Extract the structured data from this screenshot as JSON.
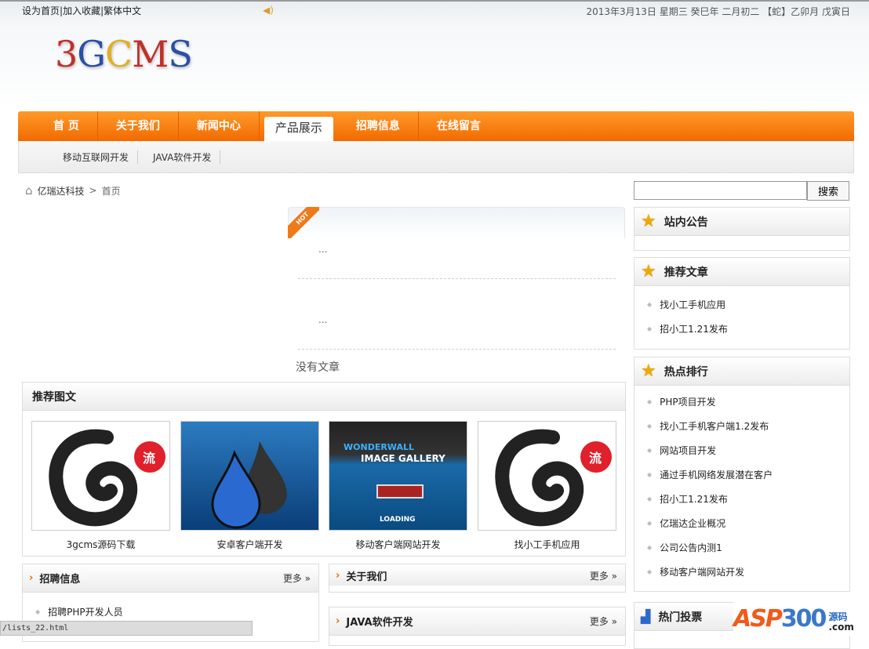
{
  "topbar": {
    "links": [
      "设为首页",
      "加入收藏",
      "繁体中文"
    ],
    "separator": "|",
    "date": "2013年3月13日 星期三  癸巳年 二月初二 【蛇】乙卯月 戊寅日"
  },
  "logo": {
    "text": "3GCMS",
    "letters": [
      "3",
      "G",
      "C",
      "M",
      "S"
    ],
    "colors": [
      "#c0302a",
      "#2a4fa8",
      "#e0b020",
      "#c0302a",
      "#2a4fa8"
    ]
  },
  "nav": {
    "items": [
      "首 页",
      "关于我们",
      "新闻中心",
      "产品展示",
      "招聘信息",
      "在线留言"
    ],
    "active": 3,
    "accent": "#f57a0a"
  },
  "subnav": {
    "items": [
      "移动互联网开发",
      "JAVA软件开发"
    ]
  },
  "breadcrumb": {
    "items": [
      "亿瑞达科技",
      "首页"
    ],
    "separator": ">"
  },
  "hot": {
    "badge": "HOT",
    "rows": [
      "...",
      "..."
    ],
    "empty": "没有文章"
  },
  "pictures": {
    "title": "推荐图文",
    "items": [
      {
        "caption": "3gcms源码下载",
        "badge": "流"
      },
      {
        "caption": "安卓客户端开发"
      },
      {
        "caption": "移动客户端网站开发",
        "line1": "WONDERWALL",
        "line2": "IMAGE GALLERY",
        "line3": "LOADING"
      },
      {
        "caption": "找小工手机应用",
        "badge": "流"
      }
    ]
  },
  "boxes": {
    "jobs": {
      "title": "招聘信息",
      "more": "更多 »",
      "items": [
        "招聘PHP开发人员"
      ]
    },
    "about": {
      "title": "关于我们",
      "more": "更多 »"
    },
    "java": {
      "title": "JAVA软件开发",
      "more": "更多 »"
    }
  },
  "search": {
    "value": "",
    "button": "搜索"
  },
  "sidebar": {
    "notice": {
      "title": "站内公告"
    },
    "recommend": {
      "title": "推荐文章",
      "items": [
        "找小工手机应用",
        "招小工1.21发布"
      ]
    },
    "hot": {
      "title": "热点排行",
      "items": [
        "PHP项目开发",
        "找小工手机客户端1.2发布",
        "网站项目开发",
        "通过手机网络发展潜在客户",
        "招小工1.21发布",
        "亿瑞达企业概况",
        "公司公告内测1",
        "移动客户端网站开发"
      ]
    },
    "vote": {
      "title": "热门投票"
    }
  },
  "status": {
    "url": "/lists_22.html"
  },
  "watermark": {
    "text": "ASP300",
    "suffix1": "源码",
    "suffix2": ".com"
  }
}
